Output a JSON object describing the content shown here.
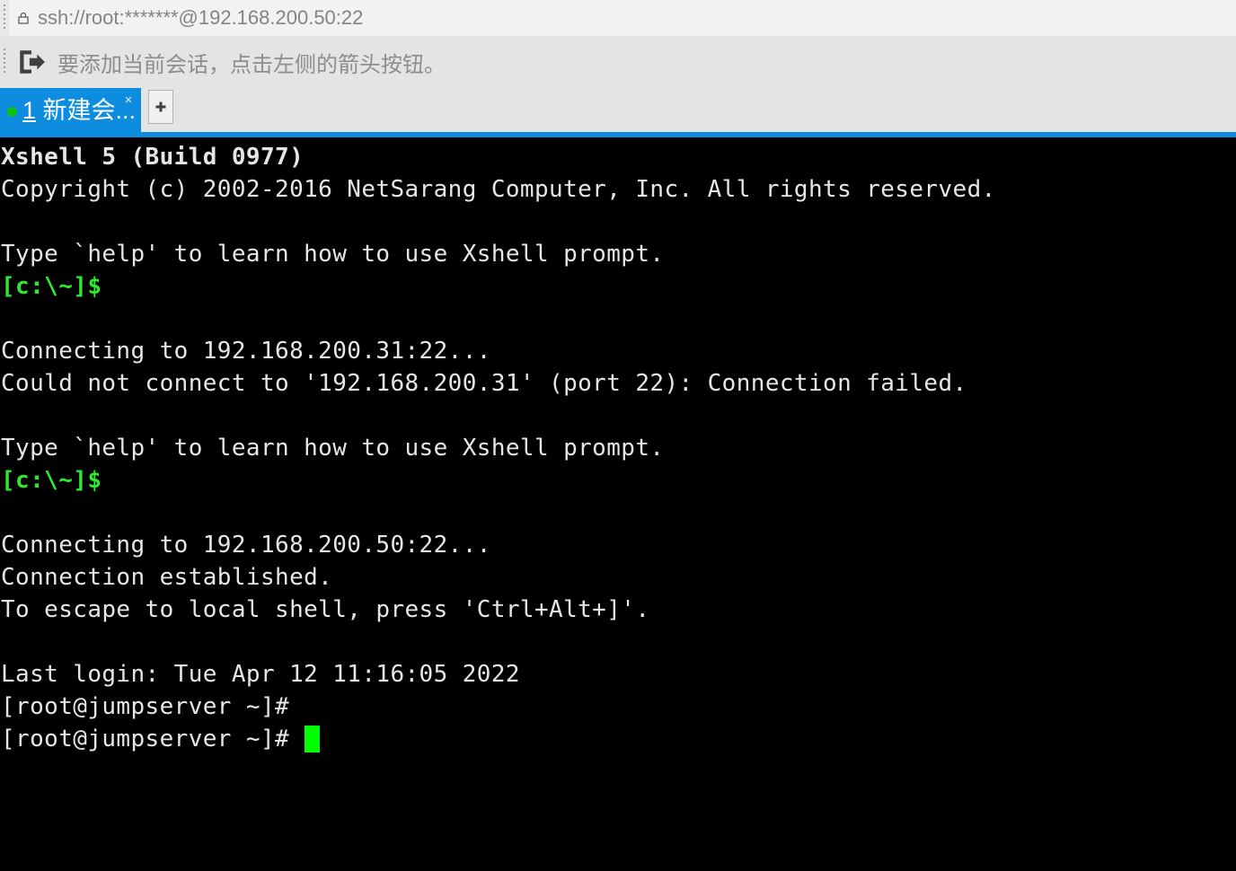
{
  "window": {
    "app_title": "Xshell 5"
  },
  "addressbar": {
    "lock_icon": "lock-icon",
    "grip_icon": "drag-grip-icon",
    "url_value": "ssh://root:*******@192.168.200.50:22",
    "url_placeholder": "ssh://host:port"
  },
  "hintbar": {
    "grip_icon": "drag-grip-icon",
    "icon": "add-session-arrow-icon",
    "message": "要添加当前会话，点击左侧的箭头按钮。"
  },
  "tabstrip": {
    "tabs": [
      {
        "status_dot_color": "#11c111",
        "number": "1",
        "title": " 新建会...",
        "close_label": "×",
        "active": true
      }
    ],
    "new_tab_label": "+",
    "accent_color": "#0d8ce0"
  },
  "terminal": {
    "colors": {
      "background": "#000000",
      "foreground": "#e6e6e6",
      "prompt_green": "#2ee82e",
      "cursor": "#00ff00"
    },
    "lines": [
      {
        "text": "Xshell 5 (Build 0977)",
        "style": "bold"
      },
      {
        "text": "Copyright (c) 2002-2016 NetSarang Computer, Inc. All rights reserved.",
        "style": "normal"
      },
      {
        "text": "",
        "style": "blank"
      },
      {
        "text": "Type `help' to learn how to use Xshell prompt.",
        "style": "normal"
      },
      {
        "text": "[c:\\~]$",
        "style": "green"
      },
      {
        "text": "",
        "style": "blank"
      },
      {
        "text": "Connecting to 192.168.200.31:22...",
        "style": "normal"
      },
      {
        "text": "Could not connect to '192.168.200.31' (port 22): Connection failed.",
        "style": "normal"
      },
      {
        "text": "",
        "style": "blank"
      },
      {
        "text": "Type `help' to learn how to use Xshell prompt.",
        "style": "normal"
      },
      {
        "text": "[c:\\~]$",
        "style": "green"
      },
      {
        "text": "",
        "style": "blank"
      },
      {
        "text": "Connecting to 192.168.200.50:22...",
        "style": "normal"
      },
      {
        "text": "Connection established.",
        "style": "normal"
      },
      {
        "text": "To escape to local shell, press 'Ctrl+Alt+]'.",
        "style": "normal"
      },
      {
        "text": "",
        "style": "blank"
      },
      {
        "text": "Last login: Tue Apr 12 11:16:05 2022",
        "style": "normal"
      },
      {
        "text": "[root@jumpserver ~]#",
        "style": "normal"
      },
      {
        "text": "[root@jumpserver ~]# ",
        "style": "cursor"
      }
    ]
  }
}
